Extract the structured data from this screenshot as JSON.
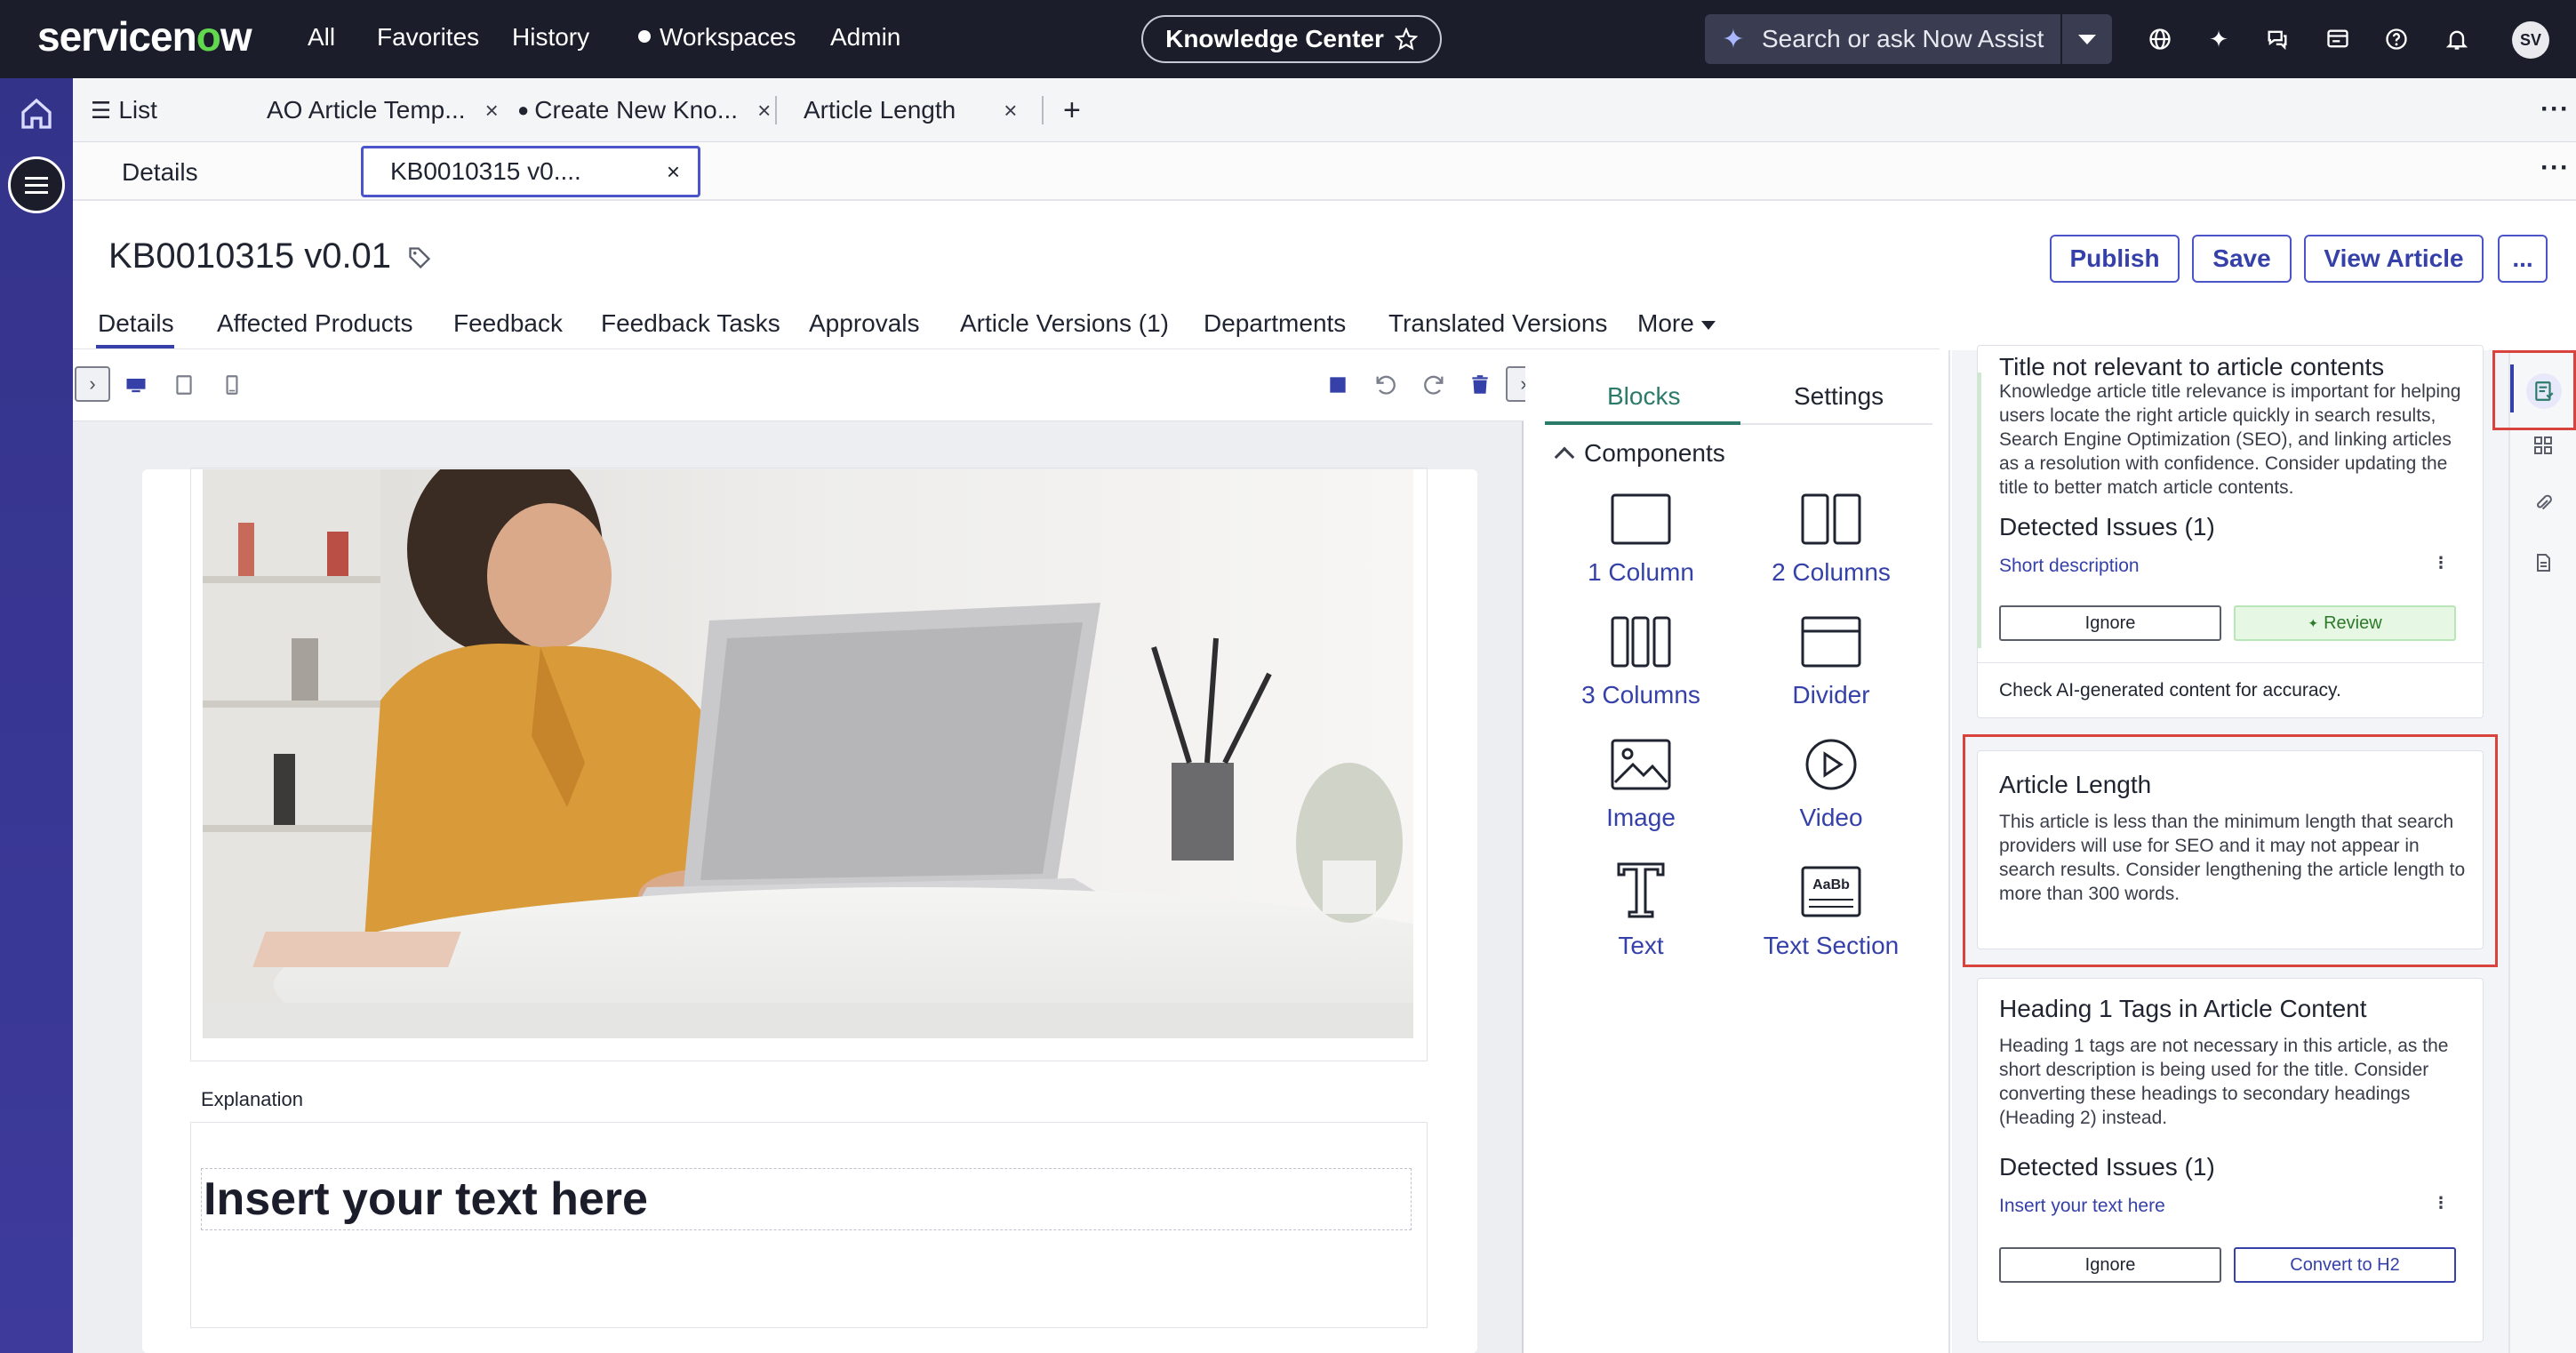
{
  "topnav": {
    "logo": "servicenow",
    "links": [
      "All",
      "Favorites",
      "History",
      "Workspaces",
      "Admin"
    ],
    "workspace_pill": "Knowledge Center",
    "search_placeholder": "Search or ask Now Assist",
    "avatar_initials": "SV"
  },
  "tabs_primary": {
    "list_label": "List",
    "tabs": [
      {
        "label": "AO Article Temp...",
        "closable": true
      },
      {
        "label": "Create New Kno...",
        "closable": true,
        "unsaved": true
      },
      {
        "label": "Article Length",
        "closable": true
      }
    ]
  },
  "tabs_secondary": {
    "details": "Details",
    "active": "KB0010315 v0...."
  },
  "record": {
    "title": "KB0010315 v0.01",
    "buttons": {
      "publish": "Publish",
      "save": "Save",
      "view": "View Article",
      "more": "..."
    }
  },
  "form_tabs": [
    "Details",
    "Affected Products",
    "Feedback",
    "Feedback Tasks",
    "Approvals",
    "Article Versions (1)",
    "Departments",
    "Translated Versions",
    "More"
  ],
  "editor": {
    "explanation_label": "Explanation",
    "text_placeholder": "Insert your text here"
  },
  "blocks_panel": {
    "tabs": [
      "Blocks",
      "Settings"
    ],
    "section": "Components",
    "components": [
      "1 Column",
      "2 Columns",
      "3 Columns",
      "Divider",
      "Image",
      "Video",
      "Text",
      "Text Section"
    ]
  },
  "guidance": {
    "card1": {
      "title": "Title not relevant to article contents",
      "body": "Knowledge article title relevance is important for helping users locate the right article quickly in search results, Search Engine Optimization (SEO), and linking articles as a resolution with confidence. Consider updating the title to better match article contents.",
      "issues_heading": "Detected Issues (1)",
      "issue_link": "Short description",
      "ignore": "Ignore",
      "review": "Review",
      "footer": "Check AI-generated content for accuracy."
    },
    "card2": {
      "title": "Article Length",
      "body": "This article is less than the minimum length that search providers will use for SEO and it may not appear in search results. Consider lengthening the article length to more than 300 words."
    },
    "card3": {
      "title": "Heading 1 Tags in Article Content",
      "body": "Heading 1 tags are not necessary in this article, as the short description is being used for the title. Consider converting these headings to secondary headings (Heading 2) instead.",
      "issues_heading": "Detected Issues (1)",
      "issue_link": "Insert your text here",
      "ignore": "Ignore",
      "convert": "Convert to H2"
    }
  },
  "colors": {
    "nav_bg": "#1b1d2b",
    "rail_bg": "#3d3a9c",
    "accent": "#3541a8",
    "teal": "#2c7a6a",
    "highlight": "#d8433d"
  }
}
